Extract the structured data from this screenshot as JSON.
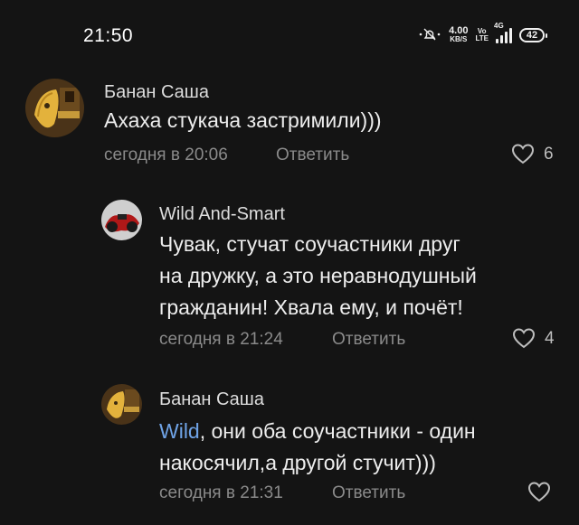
{
  "status_bar": {
    "time": "21:50",
    "net_speed": "4.00",
    "net_unit": "KB/S",
    "volte_top": "Vo",
    "volte_bottom": "LTE",
    "network": "4G",
    "battery": "42"
  },
  "comments": [
    {
      "author": "Банан Саша",
      "lines": [
        "Ахаха стукача застримили)))"
      ],
      "time": "сегодня в 20:06",
      "reply_label": "Ответить",
      "likes": "6"
    },
    {
      "author": "Wild And-Smart",
      "lines": [
        "Чувак, стучат соучастники друг",
        "на дружку, а это неравнодушный",
        "гражданин! Хвала ему, и почёт!"
      ],
      "time": "сегодня в 21:24",
      "reply_label": "Ответить",
      "likes": "4"
    },
    {
      "author": "Банан Саша",
      "mention": "Wild",
      "line1_rest": ", они оба соучастники - один",
      "line2": "накосячил,а другой стучит)))",
      "time": "сегодня в 21:31",
      "reply_label": "Ответить",
      "likes": ""
    }
  ],
  "colors": {
    "background": "#141414",
    "mention": "#6fa3e6",
    "meta": "#8a8a8a"
  },
  "icons": [
    "mute-bell-icon",
    "signal-icon",
    "battery-icon",
    "heart-icon"
  ]
}
